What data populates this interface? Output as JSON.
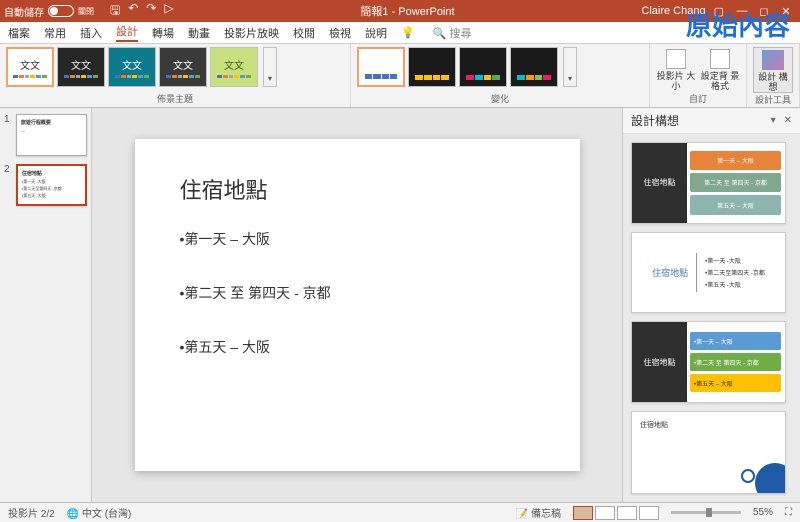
{
  "annotation": "原始內容",
  "titlebar": {
    "autosave_label": "自動儲存",
    "autosave_state": "關閉",
    "title": "簡報1 - PowerPoint",
    "user": "Claire Chang"
  },
  "menu": {
    "file": "檔案",
    "home": "常用",
    "insert": "插入",
    "design": "設計",
    "transitions": "轉場",
    "animations": "動畫",
    "slideshow": "投影片放映",
    "review": "校閱",
    "view": "檢視",
    "help": "說明",
    "search": "搜尋"
  },
  "ribbon": {
    "themes_label": "佈景主題",
    "variants_label": "變化",
    "customize_label": "自訂",
    "slide_size": "投影片\n大小",
    "format_bg": "設定背\n景格式",
    "design_tools_label": "設計工具",
    "design_ideas": "設計\n構想",
    "aa": "文文"
  },
  "slide": {
    "title": "住宿地點",
    "bullet1": "•第一天 – 大阪",
    "bullet2": "•第二天 至 第四天 - 京都",
    "bullet3": "•第五天 – 大阪"
  },
  "thumbnails": [
    {
      "num": "1",
      "title": "旅遊行程概要"
    },
    {
      "num": "2",
      "title": "住宿地點"
    }
  ],
  "ideas": {
    "header": "設計構想",
    "card_title": "住宿地點",
    "line1": "第一天 – 大阪",
    "line2": "第二天 至 第四天 - 京都",
    "line3": "第五天 – 大阪",
    "line1s": "•第一天 -大阪",
    "line2s": "•第二天至第四天 -京都",
    "line3s": "•第五天 -大阪"
  },
  "status": {
    "slide_count": "投影片 2/2",
    "lang": "中文 (台灣)",
    "notes": "備忘稿",
    "zoom": "55%"
  }
}
